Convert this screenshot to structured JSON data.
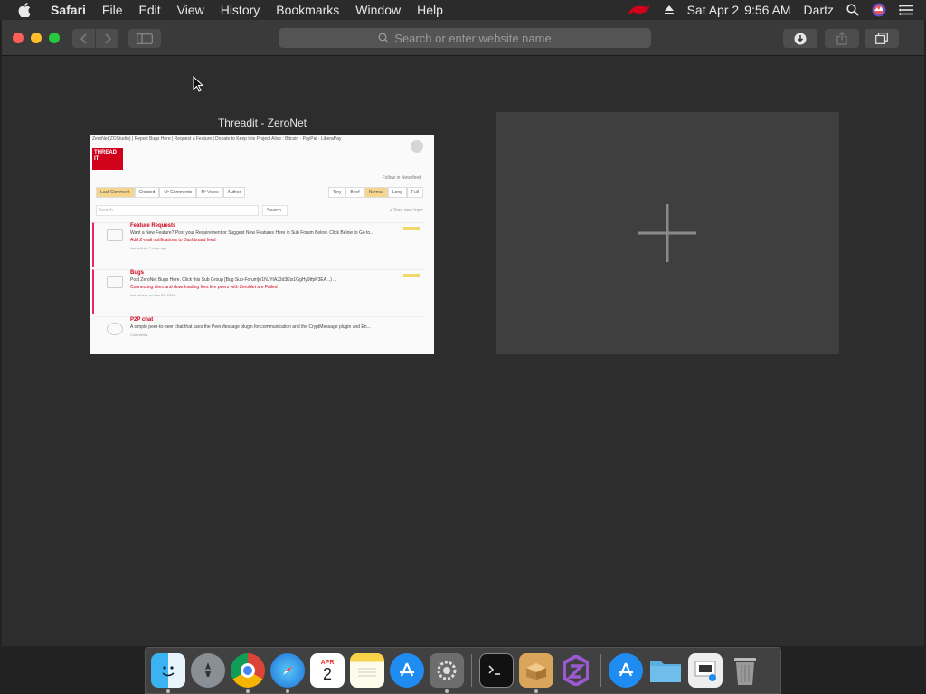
{
  "menubar": {
    "app_name": "Safari",
    "menus": [
      "File",
      "Edit",
      "View",
      "History",
      "Bookmarks",
      "Window",
      "Help"
    ],
    "date": "Sat Apr 2",
    "time": "9:56 AM",
    "user": "Dartz"
  },
  "toolbar": {
    "address_placeholder": "Search or enter website name"
  },
  "topsites": {
    "tile_title": "Threadit - ZeroNet",
    "thumbnail": {
      "top_links": "ZeroNet(ZOStudio) | Report Bugs Here | Request a Feature | Donate to Keep this Project Alive : Bitcoin · PayPal · LiberaPay",
      "logo_text": "THREAD IT",
      "follow_text": "Follow in Newsfeed",
      "sort_tabs": [
        "Last Comment",
        "Created",
        "Nº Comments",
        "Nº Votes",
        "Author"
      ],
      "length_tabs": [
        "Tiny",
        "Brief",
        "Normal",
        "Long",
        "Full"
      ],
      "search_placeholder": "Search...",
      "search_button": "Search",
      "new_topic": "+ Start new topic",
      "topics": [
        {
          "title": "Feature Requests",
          "body": "Want a New Feature? Post your Requirement or Suggest New Features Here in Sub Forum Below. Click Below to Go to...",
          "sub": "Add Z-mail notifications to Dashboard feed",
          "meta": "last activity  2 days ago"
        },
        {
          "title": "Bugs",
          "body": "Post ZeroNet Bugs Here. Click this Sub Group [Bug Sub-Forum](/1NJYtAJ3d3Kts1GgHy9tfpP3EA...) ...",
          "sub": "Connecting sites and downloading files live peers with ZeroNet are Failed",
          "meta": "last activity  on Mar 26, 2022"
        },
        {
          "title": "P2P chat",
          "body": "A simple peer-to-peer chat that uses the PeerMessage plugin for communication and the CryptMessage plugin and En...",
          "sub": "",
          "meta": "Comments"
        }
      ]
    }
  },
  "dock": {
    "apps": [
      "finder",
      "launchpad",
      "chrome",
      "safari",
      "calendar",
      "notes",
      "app-store",
      "system-preferences",
      "terminal",
      "installer",
      "zeronet",
      "app-store-folder",
      "folder",
      "preview",
      "trash"
    ],
    "calendar_month": "APR",
    "calendar_day": "2"
  },
  "colors": {
    "menubar_bg": "#2b2b2b",
    "toolbar_bg": "#3a3a3a",
    "content_bg": "#2d2d2d",
    "accent_red": "#d0021b"
  }
}
